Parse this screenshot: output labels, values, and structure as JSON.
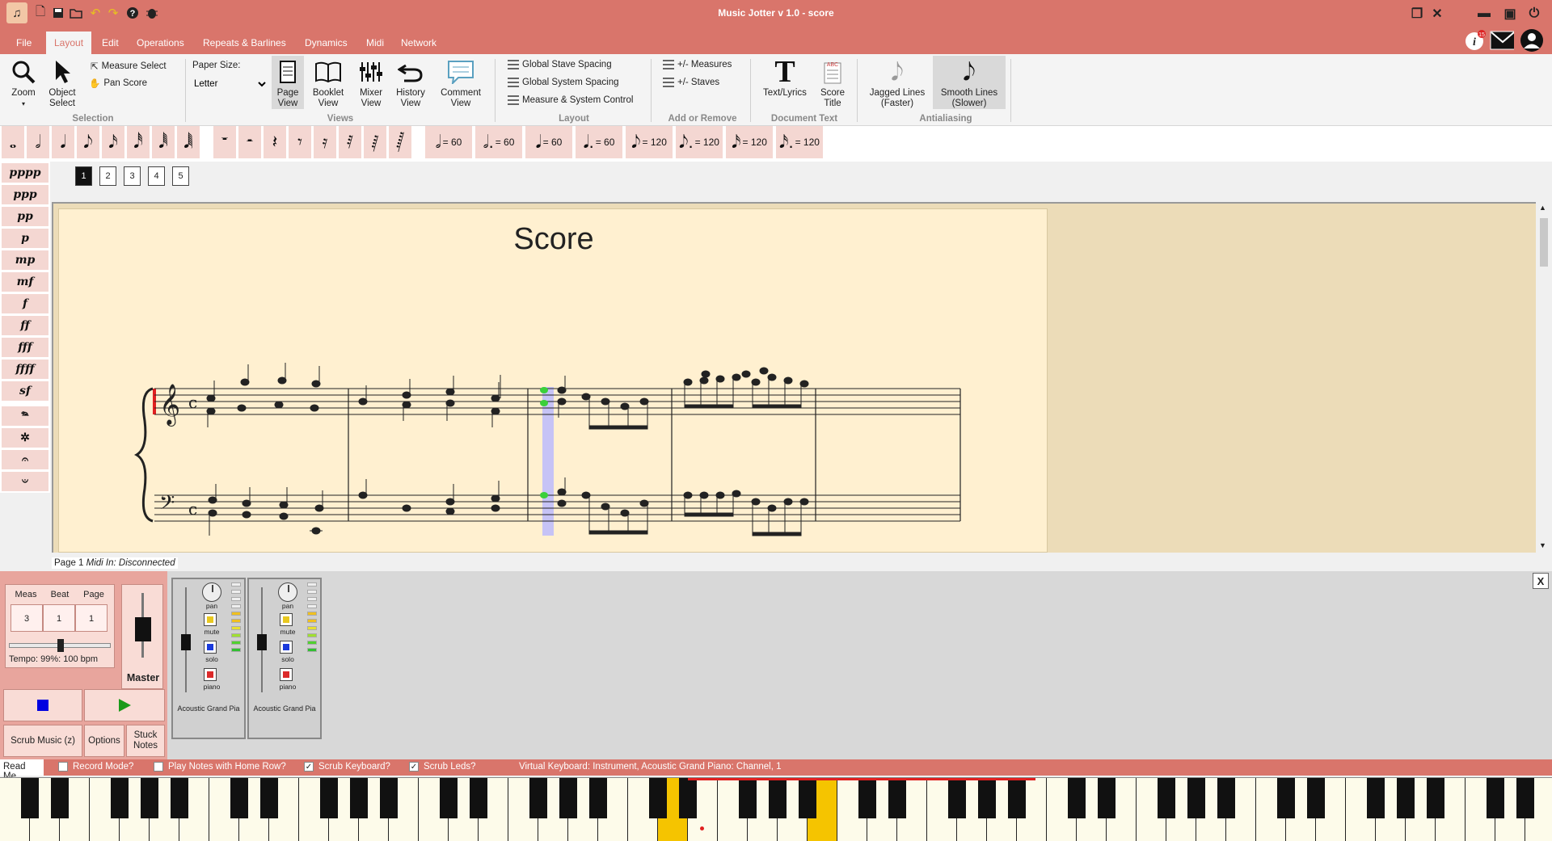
{
  "window": {
    "title": "Music Jotter v 1.0 - score"
  },
  "menu": {
    "tabs": [
      {
        "label": "File"
      },
      {
        "label": "Layout"
      },
      {
        "label": "Edit"
      },
      {
        "label": "Operations"
      },
      {
        "label": "Repeats & Barlines"
      },
      {
        "label": "Dynamics"
      },
      {
        "label": "Midi"
      },
      {
        "label": "Network"
      }
    ],
    "active": "Layout",
    "notification_count": "15"
  },
  "ribbon": {
    "selection": {
      "zoom": "Zoom",
      "object_select_1": "Object",
      "object_select_2": "Select",
      "measure_select": "Measure Select",
      "pan_score": "Pan Score",
      "group_label": "Selection"
    },
    "paper": {
      "label": "Paper Size:",
      "value": "Letter"
    },
    "views": {
      "page_1": "Page",
      "page_2": "View",
      "booklet_1": "Booklet",
      "booklet_2": "View",
      "mixer_1": "Mixer",
      "mixer_2": "View",
      "history_1": "History",
      "history_2": "View",
      "comment_1": "Comment",
      "comment_2": "View",
      "group_label": "Views"
    },
    "layout": {
      "global_stave": "Global Stave Spacing",
      "global_system": "Global System Spacing",
      "measure_system": "Measure & System Control",
      "group_label": "Layout"
    },
    "add_remove": {
      "measures": "+/- Measures",
      "staves": "+/- Staves",
      "group_label": "Add or Remove"
    },
    "document_text": {
      "text_lyrics": "Text/Lyrics",
      "score_title_1": "Score",
      "score_title_2": "Title",
      "group_label": "Document Text"
    },
    "antialiasing": {
      "jagged_1": "Jagged Lines",
      "jagged_2": "(Faster)",
      "smooth_1": "Smooth Lines",
      "smooth_2": "(Slower)",
      "group_label": "Antialiasing"
    }
  },
  "note_palette": {
    "tempo_buttons": [
      "= 60",
      "= 60",
      "= 60",
      "= 60",
      "= 120",
      "= 120",
      "= 120",
      "= 120"
    ]
  },
  "dynamics": [
    "pppp",
    "ppp",
    "pp",
    "p",
    "mp",
    "mf",
    "f",
    "ff",
    "fff",
    "ffff",
    "sf"
  ],
  "pages": [
    "1",
    "2",
    "3",
    "4",
    "5"
  ],
  "score": {
    "title": "Score"
  },
  "status": {
    "page": "Page 1",
    "midi": "Midi In: Disconnected"
  },
  "transport": {
    "meas_label": "Meas",
    "beat_label": "Beat",
    "page_label": "Page",
    "meas": "3",
    "beat": "1",
    "page": "1",
    "tempo": "Tempo: 99%: 100 bpm",
    "tempo_fraction": 0.5,
    "master": "Master",
    "scrub": "Scrub Music (z)",
    "options": "Options",
    "stuck_1": "Stuck",
    "stuck_2": "Notes",
    "stop_color": "#0000e0",
    "play_color": "#1a9a1a"
  },
  "mixer_strips": [
    {
      "name": "Acoustic Grand Pia",
      "pan": "pan",
      "mute": "mute",
      "solo": "solo",
      "piano": "piano"
    },
    {
      "name": "Acoustic Grand Pia",
      "pan": "pan",
      "mute": "mute",
      "solo": "solo",
      "piano": "piano"
    }
  ],
  "options_bar": {
    "readme": "Read Me",
    "record": "Record Mode?",
    "record_checked": false,
    "home_row": "Play Notes with Home Row?",
    "home_row_checked": false,
    "scrub_keyboard": "Scrub Keyboard?",
    "scrub_keyboard_checked": true,
    "scrub_leds": "Scrub Leds?",
    "scrub_leds_checked": true,
    "virtual_keyboard": "Virtual Keyboard: Instrument, Acoustic Grand Piano: Channel, 1"
  },
  "colors": {
    "accent": "#d9756b",
    "score_bg": "#fff0d0",
    "highlight_key": "#f5c400"
  }
}
